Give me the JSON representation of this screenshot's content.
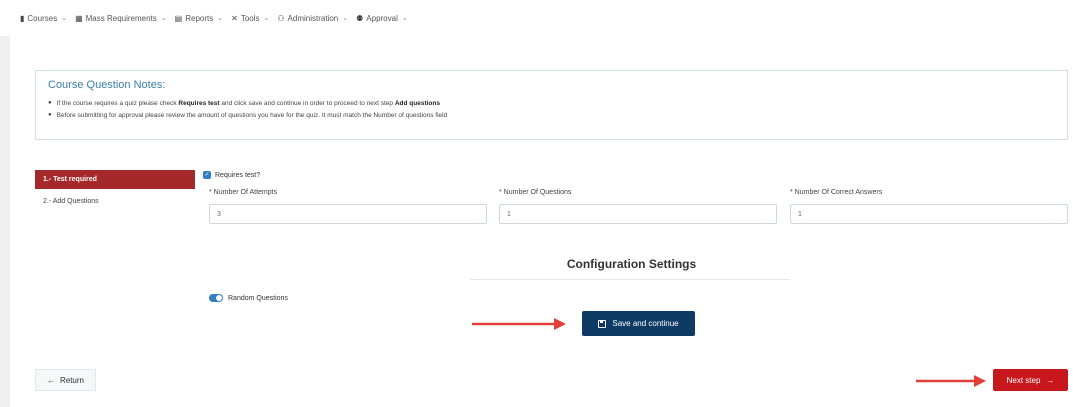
{
  "nav": {
    "items": [
      {
        "icon": "book-icon",
        "glyph": "▮",
        "label": "Courses"
      },
      {
        "icon": "grid-icon",
        "glyph": "▦",
        "label": "Mass Requirements"
      },
      {
        "icon": "report-icon",
        "glyph": "▤",
        "label": "Reports"
      },
      {
        "icon": "tools-icon",
        "glyph": "✕",
        "label": "Tools"
      },
      {
        "icon": "users-icon",
        "glyph": "⚇",
        "label": "Administration"
      },
      {
        "icon": "approval-icon",
        "glyph": "⚉",
        "label": "Approval"
      }
    ],
    "chevron": "⌄"
  },
  "notes": {
    "title": "Course Question Notes:",
    "line1_a": "If the course requires a quiz please check ",
    "line1_b": "Requires test",
    "line1_c": " and click save and continue in order to proceed to next step ",
    "line1_d": "Add questions",
    "line2": "Before submitting for approval please review the amount of questions you have for the quiz. It must match the Number of questions field"
  },
  "steps": {
    "step1": "1.- Test required",
    "step2": "2.- Add Questions"
  },
  "form": {
    "requires_test_label": "Requires test?",
    "requires_test_checked": true,
    "attempts_label": "* Number Of Attempts",
    "attempts_value": "3",
    "questions_label": "* Number Of Questions",
    "questions_value": "1",
    "correct_label": "* Number Of Correct Answers",
    "correct_value": "1"
  },
  "config": {
    "title": "Configuration Settings",
    "random_label": "Random Questions",
    "random_on": true
  },
  "buttons": {
    "save": "Save and continue",
    "return": "Return",
    "next": "Next step",
    "return_arrow": "←",
    "next_arrow": "→"
  },
  "colors": {
    "step_active": "#a5282a",
    "save_button": "#0d3b66",
    "next_button": "#c8161d",
    "annotation_arrow": "#e0403a",
    "accent_blue": "#2f7ec6"
  }
}
